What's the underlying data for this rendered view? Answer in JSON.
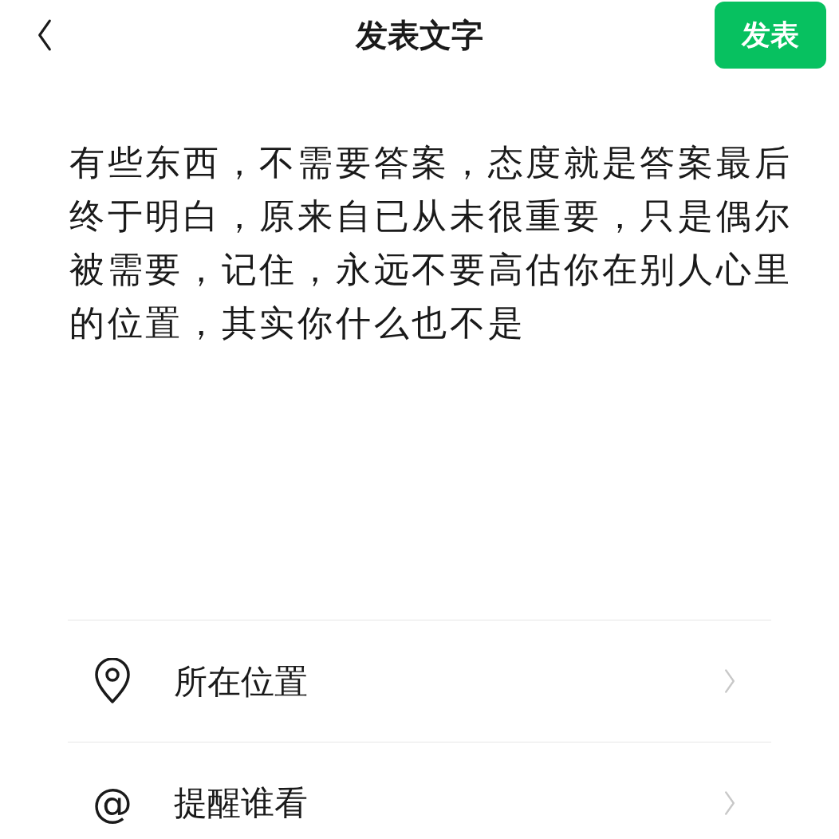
{
  "header": {
    "title": "发表文字",
    "publish_button": "发表"
  },
  "post": {
    "text": "有些东西，不需要答案，态度就是答案最后终于明白，原来自已从未很重要，只是偶尔被需要，记住，永远不要高估你在别人心里的位置，其实你什么也不是"
  },
  "options": [
    {
      "kind": "location",
      "label": "所在位置"
    },
    {
      "kind": "mention",
      "symbol": "@",
      "label": "提醒谁看"
    }
  ]
}
